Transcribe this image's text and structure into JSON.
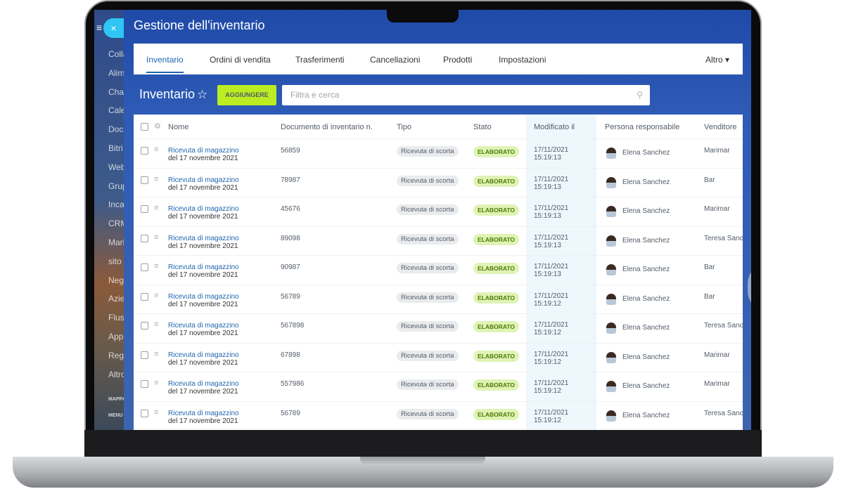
{
  "sidebar": {
    "items": [
      "Colla",
      "Alim",
      "Chat",
      "Cale",
      "Docu",
      "Bitri",
      "Web",
      "Grup",
      "Inca",
      "CRM",
      "Mark",
      "sito",
      "Nego",
      "Azie",
      "Fluss",
      "Appl",
      "Regi",
      "Altro"
    ],
    "footer": [
      "MAPPA",
      "MENU"
    ],
    "close_icon": "×",
    "menu_icon": "≡"
  },
  "header": {
    "title": "Gestione dell'inventario"
  },
  "tabs": [
    {
      "label": "Inventario",
      "active": true
    },
    {
      "label": "Ordini di vendita"
    },
    {
      "label": "Trasferimenti"
    },
    {
      "label": "Cancellazioni"
    },
    {
      "label": "Prodotti"
    },
    {
      "label": "Impostazioni"
    }
  ],
  "more_tab": "Altro ▾",
  "page": {
    "title": "Inventario",
    "add_label": "AGGIUNGERE",
    "search_placeholder": "Filtra e cerca"
  },
  "colors": {
    "accent": "#2067b0",
    "add_button": "#bbed21",
    "status_badge": "#dff3b5"
  },
  "table": {
    "columns": [
      "Nome",
      "Documento di inventario n.",
      "Tipo",
      "Stato",
      "Modificato il",
      "Persona responsabile",
      "Venditore"
    ],
    "rows": [
      {
        "name": "Ricevuta di magazzino",
        "date_line": "del 17 novembre 2021",
        "doc": "56859",
        "type": "Ricevuta di scorta",
        "status": "ELABORATO",
        "modified_date": "17/11/2021",
        "modified_time": "15:19:13",
        "person": "Elena Sanchez",
        "vendor": "Marimar"
      },
      {
        "name": "Ricevuta di magazzino",
        "date_line": "del 17 novembre 2021",
        "doc": "78987",
        "type": "Ricevuta di scorta",
        "status": "ELABORATO",
        "modified_date": "17/11/2021",
        "modified_time": "15:19:13",
        "person": "Elena Sanchez",
        "vendor": "Bar"
      },
      {
        "name": "Ricevuta di magazzino",
        "date_line": "del 17 novembre 2021",
        "doc": "45676",
        "type": "Ricevuta di scorta",
        "status": "ELABORATO",
        "modified_date": "17/11/2021",
        "modified_time": "15:19:13",
        "person": "Elena Sanchez",
        "vendor": "Marimar"
      },
      {
        "name": "Ricevuta di magazzino",
        "date_line": "del 17 novembre 2021",
        "doc": "89098",
        "type": "Ricevuta di scorta",
        "status": "ELABORATO",
        "modified_date": "17/11/2021",
        "modified_time": "15:19:13",
        "person": "Elena Sanchez",
        "vendor": "Teresa Sanchez"
      },
      {
        "name": "Ricevuta di magazzino",
        "date_line": "del 17 novembre 2021",
        "doc": "90987",
        "type": "Ricevuta di scorta",
        "status": "ELABORATO",
        "modified_date": "17/11/2021",
        "modified_time": "15:19:13",
        "person": "Elena Sanchez",
        "vendor": "Bar"
      },
      {
        "name": "Ricevuta di magazzino",
        "date_line": "del 17 novembre 2021",
        "doc": "56789",
        "type": "Ricevuta di scorta",
        "status": "ELABORATO",
        "modified_date": "17/11/2021",
        "modified_time": "15:19:12",
        "person": "Elena Sanchez",
        "vendor": "Bar"
      },
      {
        "name": "Ricevuta di magazzino",
        "date_line": "del 17 novembre 2021",
        "doc": "567898",
        "type": "Ricevuta di scorta",
        "status": "ELABORATO",
        "modified_date": "17/11/2021",
        "modified_time": "15:19:12",
        "person": "Elena Sanchez",
        "vendor": "Teresa Sanchez"
      },
      {
        "name": "Ricevuta di magazzino",
        "date_line": "del 17 novembre 2021",
        "doc": "67898",
        "type": "Ricevuta di scorta",
        "status": "ELABORATO",
        "modified_date": "17/11/2021",
        "modified_time": "15:19:12",
        "person": "Elena Sanchez",
        "vendor": "Marimar"
      },
      {
        "name": "Ricevuta di magazzino",
        "date_line": "del 17 novembre 2021",
        "doc": "557986",
        "type": "Ricevuta di scorta",
        "status": "ELABORATO",
        "modified_date": "17/11/2021",
        "modified_time": "15:19:12",
        "person": "Elena Sanchez",
        "vendor": "Marimar"
      },
      {
        "name": "Ricevuta di magazzino",
        "date_line": "del 17 novembre 2021",
        "doc": "56789",
        "type": "Ricevuta di scorta",
        "status": "ELABORATO",
        "modified_date": "17/11/2021",
        "modified_time": "15:19:12",
        "person": "Elena Sanchez",
        "vendor": "Teresa Sanchez"
      }
    ]
  }
}
